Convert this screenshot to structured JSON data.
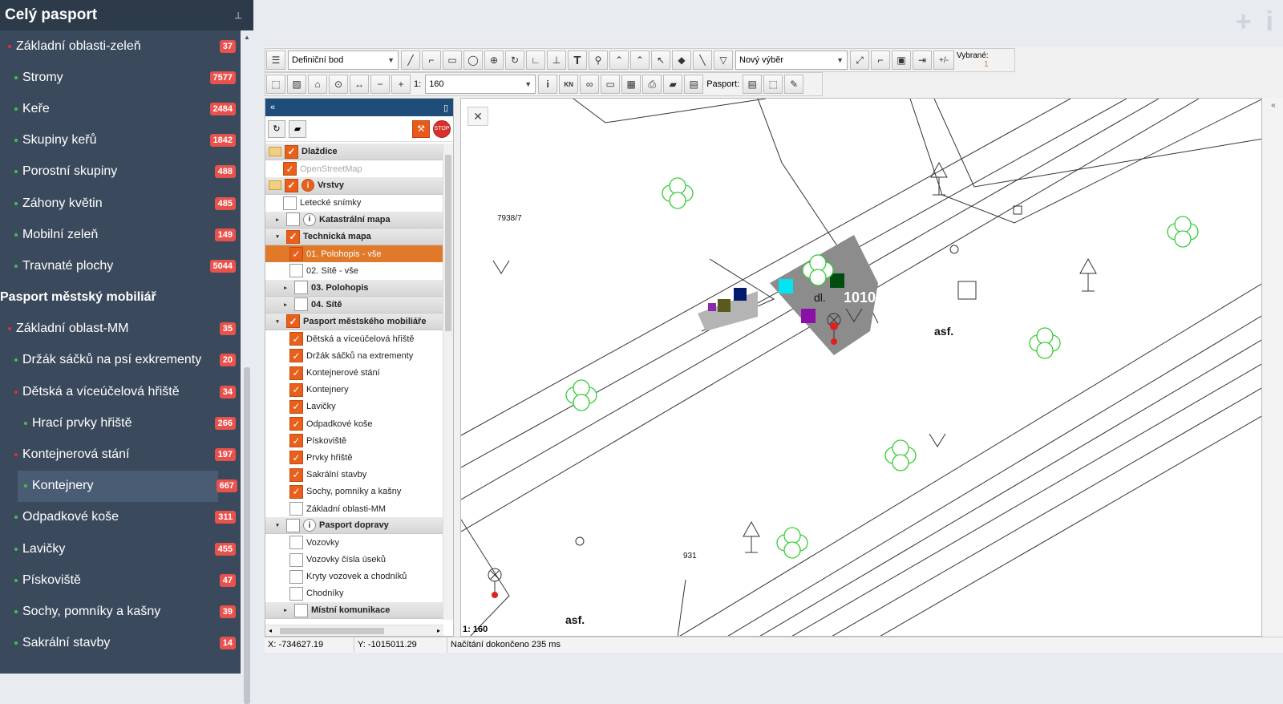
{
  "sidebar": {
    "title": "Celý pasport",
    "items": [
      {
        "label": "Základní oblasti-zeleň",
        "count": "37",
        "dot": "red",
        "level": 1
      },
      {
        "label": "Stromy",
        "count": "7577",
        "dot": "green",
        "level": 2
      },
      {
        "label": "Keře",
        "count": "2484",
        "dot": "green",
        "level": 2
      },
      {
        "label": "Skupiny keřů",
        "count": "1842",
        "dot": "green",
        "level": 2
      },
      {
        "label": "Porostní skupiny",
        "count": "488",
        "dot": "green",
        "level": 2
      },
      {
        "label": "Záhony květin",
        "count": "485",
        "dot": "green",
        "level": 2
      },
      {
        "label": "Mobilní zeleň",
        "count": "149",
        "dot": "green",
        "level": 2
      },
      {
        "label": "Travnaté plochy",
        "count": "5044",
        "dot": "green",
        "level": 2
      },
      {
        "label": "Pasport městský mobiliář",
        "count": "",
        "dot": "",
        "level": 0
      },
      {
        "label": "Základní oblast-MM",
        "count": "35",
        "dot": "red",
        "level": 1
      },
      {
        "label": "Držák sáčků na psí exkrementy",
        "count": "20",
        "dot": "green",
        "level": 2
      },
      {
        "label": "Dětská a víceúčelová hřiště",
        "count": "34",
        "dot": "red",
        "level": 2
      },
      {
        "label": "Hrací prvky hřiště",
        "count": "266",
        "dot": "green",
        "level": 3
      },
      {
        "label": "Kontejnerová stání",
        "count": "197",
        "dot": "red",
        "level": 2
      },
      {
        "label": "Kontejnery",
        "count": "667",
        "dot": "green",
        "level": 3,
        "active": true
      },
      {
        "label": "Odpadkové koše",
        "count": "311",
        "dot": "green",
        "level": 2
      },
      {
        "label": "Lavičky",
        "count": "455",
        "dot": "green",
        "level": 2
      },
      {
        "label": "Pískoviště",
        "count": "47",
        "dot": "green",
        "level": 2
      },
      {
        "label": "Sochy, pomníky a kašny",
        "count": "39",
        "dot": "green",
        "level": 2
      },
      {
        "label": "Sakrální stavby",
        "count": "14",
        "dot": "green",
        "level": 2
      }
    ]
  },
  "top_icons": [
    "plus-icon",
    "info-icon"
  ],
  "toolbar1": {
    "draw_select": "Definiční bod",
    "selection_select": "Nový výběr",
    "plusminus": "+/-",
    "selected_label": "Vybrané:",
    "selected_count": "1"
  },
  "toolbar2": {
    "scale_prefix": "1:",
    "scale_value": "160",
    "pasport_label": "Pasport:"
  },
  "layers": [
    {
      "label": "Dlaždice",
      "type": "folder",
      "checked": true,
      "indent": 0
    },
    {
      "label": "OpenStreetMap",
      "type": "item",
      "checked": true,
      "indent": 1,
      "dim": true
    },
    {
      "label": "Vrstvy",
      "type": "folder-info",
      "checked": true,
      "indent": 0
    },
    {
      "label": "Letecké snímky",
      "type": "item",
      "checked": false,
      "indent": 1
    },
    {
      "label": "Katastrální mapa",
      "type": "group-info",
      "checked": false,
      "indent": 1,
      "exp": "▸"
    },
    {
      "label": "Technická mapa",
      "type": "group",
      "checked": true,
      "indent": 1,
      "exp": "▾"
    },
    {
      "label": "01. Polohopis - vše",
      "type": "selected",
      "checked": true,
      "indent": 2
    },
    {
      "label": "02. Sítě - vše",
      "type": "item",
      "checked": false,
      "indent": 2
    },
    {
      "label": "03. Polohopis",
      "type": "group",
      "checked": false,
      "indent": 2,
      "exp": "▸"
    },
    {
      "label": "04. Sítě",
      "type": "group",
      "checked": false,
      "indent": 2,
      "exp": "▸"
    },
    {
      "label": "Pasport městského mobiliáře",
      "type": "group",
      "checked": true,
      "indent": 1,
      "exp": "▾"
    },
    {
      "label": "Dětská a víceúčelová hřiště",
      "type": "item",
      "checked": true,
      "indent": 2
    },
    {
      "label": "Držák sáčků na extrementy",
      "type": "item",
      "checked": true,
      "indent": 2
    },
    {
      "label": "Kontejnerové stání",
      "type": "item",
      "checked": true,
      "indent": 2
    },
    {
      "label": "Kontejnery",
      "type": "item",
      "checked": true,
      "indent": 2
    },
    {
      "label": "Lavičky",
      "type": "item",
      "checked": true,
      "indent": 2
    },
    {
      "label": "Odpadkové koše",
      "type": "item",
      "checked": true,
      "indent": 2
    },
    {
      "label": "Pískoviště",
      "type": "item",
      "checked": true,
      "indent": 2
    },
    {
      "label": "Prvky hřiště",
      "type": "item",
      "checked": true,
      "indent": 2
    },
    {
      "label": "Sakrální stavby",
      "type": "item",
      "checked": true,
      "indent": 2
    },
    {
      "label": "Sochy, pomníky a kašny",
      "type": "item",
      "checked": true,
      "indent": 2
    },
    {
      "label": "Základní oblasti-MM",
      "type": "item",
      "checked": false,
      "indent": 2
    },
    {
      "label": "Pasport dopravy",
      "type": "group-info",
      "checked": false,
      "indent": 1,
      "exp": "▾"
    },
    {
      "label": "Vozovky",
      "type": "item",
      "checked": false,
      "indent": 2
    },
    {
      "label": "Vozovky čísla úseků",
      "type": "item",
      "checked": false,
      "indent": 2
    },
    {
      "label": "Kryty vozovek a chodníků",
      "type": "item",
      "checked": false,
      "indent": 2
    },
    {
      "label": "Chodníky",
      "type": "item",
      "checked": false,
      "indent": 2
    },
    {
      "label": "Místní komunikace",
      "type": "group",
      "checked": false,
      "indent": 2,
      "exp": "▸"
    }
  ],
  "map": {
    "parcel_labels": [
      "7938/7",
      "931"
    ],
    "surface_labels": [
      "asf.",
      "asf."
    ],
    "building_label": "dl.",
    "house_number": "1010",
    "scale_text": "1: 160",
    "close_symbol": "✕"
  },
  "status": {
    "x": "X: -734627.19",
    "y": "Y: -1015011.29",
    "message": "Načítání dokončeno 235 ms"
  },
  "colors": {
    "sidebar_bg": "#3a4a5c",
    "badge": "#e8524d",
    "check_orange": "#e8601c",
    "tree_green": "#33cc33"
  }
}
